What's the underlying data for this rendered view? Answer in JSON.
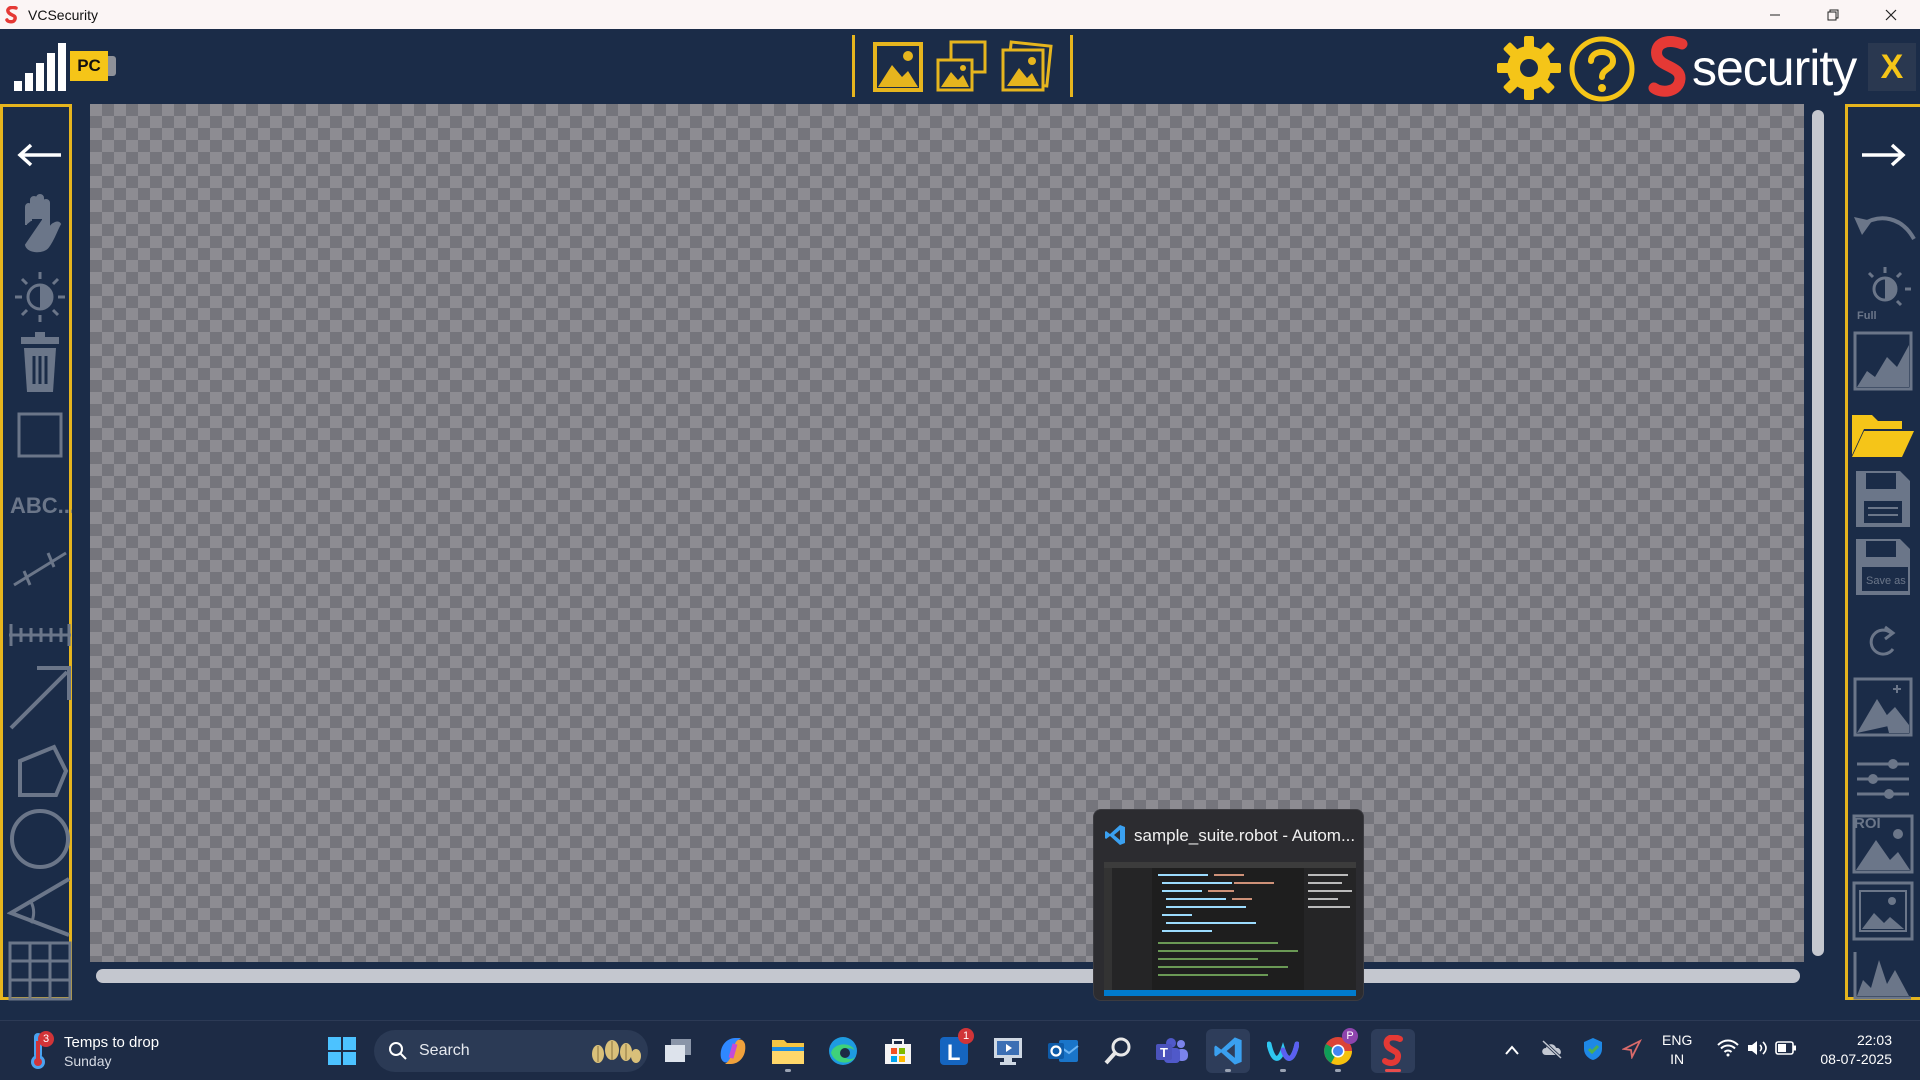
{
  "window": {
    "title": "VCSecurity"
  },
  "header": {
    "pc_label": "PC",
    "brand_text": "security",
    "close_label": "X"
  },
  "taskbar": {
    "weather": {
      "line1": "Temps to drop",
      "line2": "Sunday",
      "badge": "3"
    },
    "search_label": "Search",
    "app_badge_l": "1",
    "chrome_badge": "P",
    "lang_line1": "ENG",
    "lang_line2": "IN",
    "time": "22:03",
    "date": "08-07-2025"
  },
  "thumbnail": {
    "title": "sample_suite.robot - Autom..."
  },
  "colors": {
    "accent": "#e6b51e",
    "brand_red": "#e53935",
    "background": "#1b2c48"
  }
}
